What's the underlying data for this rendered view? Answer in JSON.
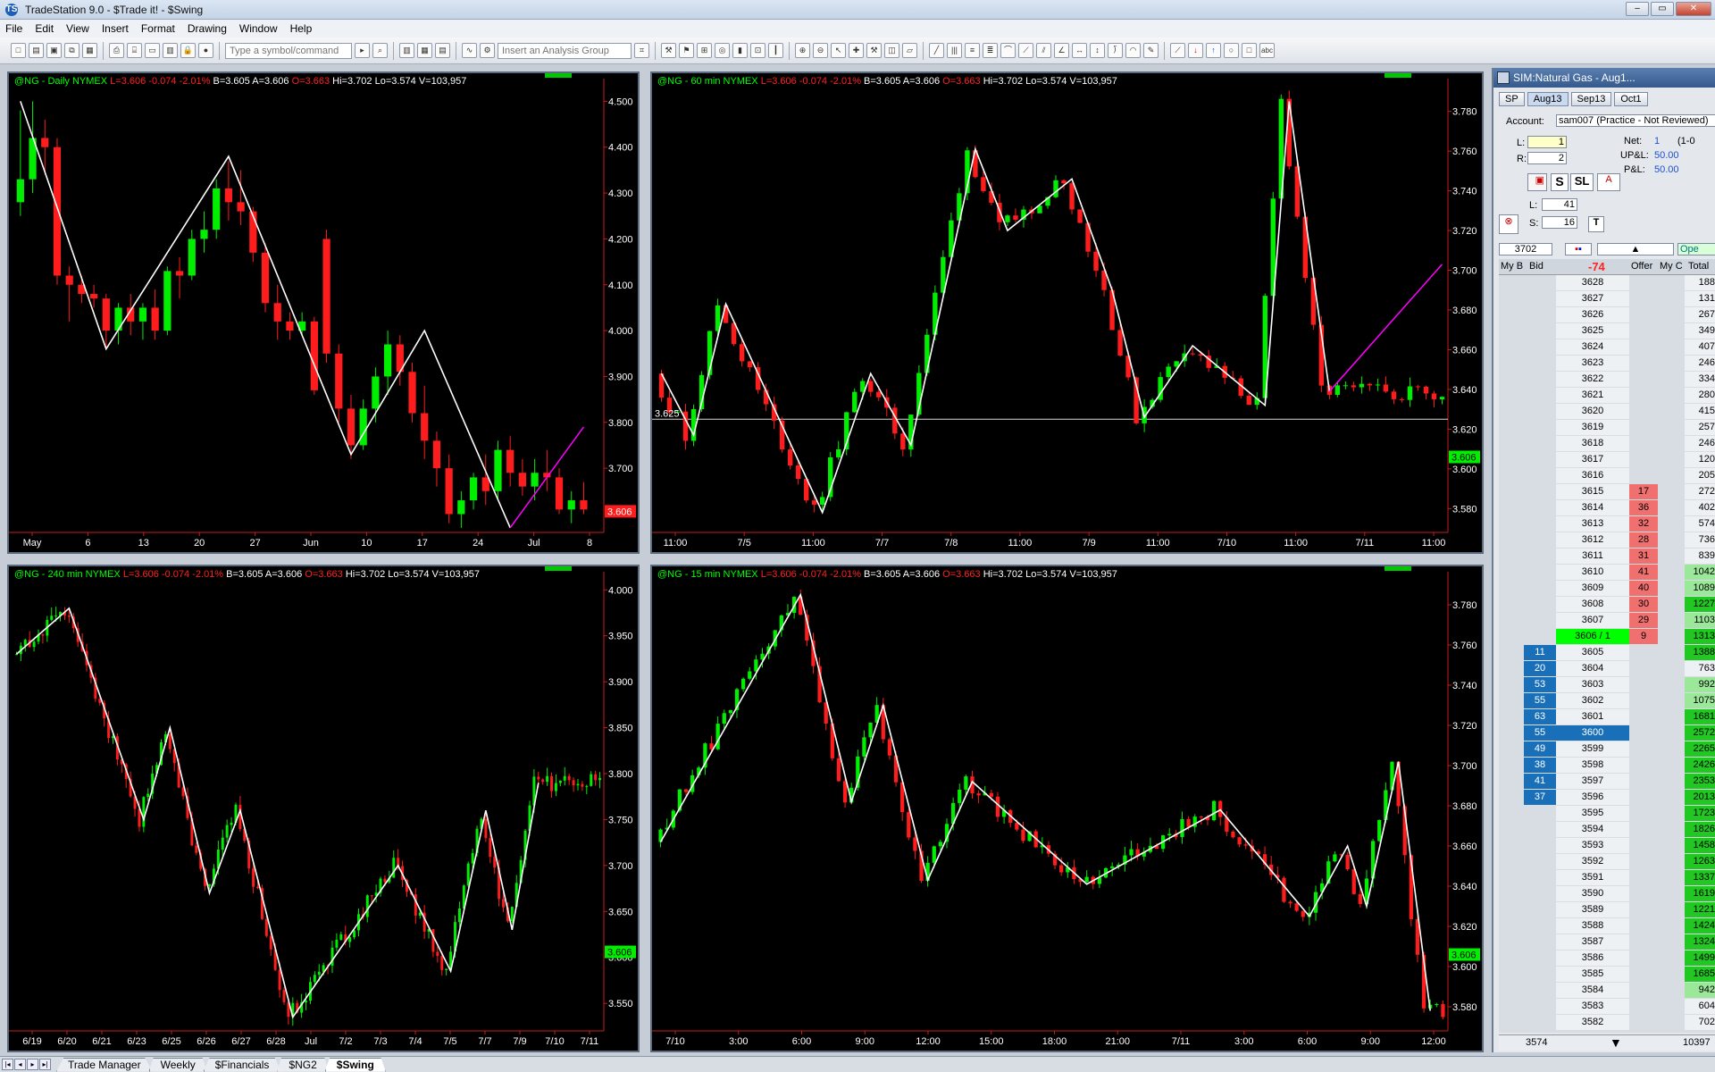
{
  "window": {
    "title": "TradeStation 9.0 - $Trade it! - $Swing",
    "logo": "TS"
  },
  "menu": [
    "File",
    "Edit",
    "View",
    "Insert",
    "Format",
    "Drawing",
    "Window",
    "Help"
  ],
  "toolbar": {
    "symbol_placeholder": "Type a symbol/command",
    "analysis_placeholder": "Insert an Analysis Group"
  },
  "colors": {
    "up": "#00ee00",
    "down": "#ff1c1c",
    "swing": "#ffffff",
    "projection": "#ff00ff",
    "axis": "#c81e1e"
  },
  "charts": [
    {
      "id": "daily",
      "sym": "@NG - Daily",
      "exch": "NYMEX",
      "last": "L=3.606",
      "chg": "-0.074",
      "pct": "-2.01%",
      "bid": "B=3.605",
      "ask": "A=3.606",
      "open": "O=3.663",
      "hi": "Hi=3.702",
      "lo": "Lo=3.574",
      "vol": "V=103,957",
      "ylim": [
        3.56,
        4.53
      ],
      "yticks": [
        "4.500",
        "4.400",
        "4.300",
        "4.200",
        "4.100",
        "4.000",
        "3.900",
        "3.800",
        "3.700"
      ],
      "ytick_values": [
        4.5,
        4.4,
        4.3,
        4.2,
        4.1,
        4.0,
        3.9,
        3.8,
        3.7
      ],
      "xticks": [
        "May",
        "6",
        "13",
        "20",
        "27",
        "Jun",
        "10",
        "17",
        "24",
        "Jul",
        "8"
      ],
      "price_label": "3.606",
      "price": 3.606,
      "price_box_color": "#ff1c1c",
      "swing": [
        [
          0,
          4.5
        ],
        [
          7,
          3.96
        ],
        [
          17,
          4.38
        ],
        [
          27,
          3.73
        ],
        [
          33,
          4.0
        ],
        [
          40,
          3.57
        ]
      ],
      "proj": [
        [
          40,
          3.57
        ],
        [
          46,
          3.79
        ]
      ],
      "hline": null,
      "hline_label": null,
      "nbars": 48,
      "bars": [
        [
          4.28,
          4.48,
          4.25,
          4.33
        ],
        [
          4.33,
          4.5,
          4.3,
          4.42
        ],
        [
          4.42,
          4.46,
          4.34,
          4.4
        ],
        [
          4.4,
          4.42,
          4.1,
          4.12
        ],
        [
          4.12,
          4.14,
          4.02,
          4.1
        ],
        [
          4.1,
          4.12,
          4.06,
          4.08
        ],
        [
          4.08,
          4.1,
          4.05,
          4.07
        ],
        [
          4.07,
          4.08,
          3.96,
          4.0
        ],
        [
          4.0,
          4.06,
          3.97,
          4.05
        ],
        [
          4.05,
          4.08,
          3.99,
          4.02
        ],
        [
          4.02,
          4.06,
          3.98,
          4.05
        ],
        [
          4.05,
          4.09,
          3.98,
          4.0
        ],
        [
          4.0,
          4.14,
          3.99,
          4.13
        ],
        [
          4.13,
          4.16,
          4.07,
          4.12
        ],
        [
          4.12,
          4.22,
          4.11,
          4.2
        ],
        [
          4.2,
          4.26,
          4.17,
          4.22
        ],
        [
          4.22,
          4.33,
          4.2,
          4.31
        ],
        [
          4.31,
          4.37,
          4.24,
          4.28
        ],
        [
          4.28,
          4.35,
          4.23,
          4.26
        ],
        [
          4.26,
          4.27,
          4.15,
          4.17
        ],
        [
          4.17,
          4.19,
          4.04,
          4.06
        ],
        [
          4.06,
          4.1,
          3.98,
          4.02
        ],
        [
          4.02,
          4.04,
          3.98,
          4.0
        ],
        [
          4.0,
          4.04,
          3.99,
          4.02
        ],
        [
          4.02,
          4.03,
          3.86,
          3.87
        ],
        [
          4.2,
          4.22,
          3.93,
          3.95
        ],
        [
          3.95,
          3.97,
          3.8,
          3.83
        ],
        [
          3.83,
          3.86,
          3.72,
          3.75
        ],
        [
          3.75,
          3.85,
          3.74,
          3.83
        ],
        [
          3.83,
          3.92,
          3.8,
          3.9
        ],
        [
          3.9,
          4.0,
          3.86,
          3.97
        ],
        [
          3.97,
          3.99,
          3.88,
          3.91
        ],
        [
          3.91,
          3.93,
          3.8,
          3.82
        ],
        [
          3.82,
          3.88,
          3.72,
          3.76
        ],
        [
          3.76,
          3.78,
          3.66,
          3.7
        ],
        [
          3.7,
          3.73,
          3.58,
          3.6
        ],
        [
          3.6,
          3.65,
          3.57,
          3.63
        ],
        [
          3.63,
          3.69,
          3.61,
          3.68
        ],
        [
          3.68,
          3.73,
          3.62,
          3.65
        ],
        [
          3.65,
          3.76,
          3.63,
          3.74
        ],
        [
          3.74,
          3.77,
          3.66,
          3.69
        ],
        [
          3.69,
          3.72,
          3.64,
          3.66
        ],
        [
          3.66,
          3.72,
          3.63,
          3.69
        ],
        [
          3.69,
          3.74,
          3.65,
          3.68
        ],
        [
          3.68,
          3.7,
          3.6,
          3.61
        ],
        [
          3.61,
          3.65,
          3.58,
          3.63
        ],
        [
          3.63,
          3.67,
          3.6,
          3.61
        ]
      ]
    },
    {
      "id": "m60",
      "sym": "@NG - 60 min",
      "exch": "NYMEX",
      "last": "L=3.606",
      "chg": "-0.074",
      "pct": "-2.01%",
      "bid": "B=3.605",
      "ask": "A=3.606",
      "open": "O=3.663",
      "hi": "Hi=3.702",
      "lo": "Lo=3.574",
      "vol": "V=103,957",
      "ylim": [
        3.568,
        3.792
      ],
      "yticks": [
        "3.780",
        "3.760",
        "3.740",
        "3.720",
        "3.700",
        "3.680",
        "3.660",
        "3.640",
        "3.620",
        "3.600",
        "3.580"
      ],
      "ytick_values": [
        3.78,
        3.76,
        3.74,
        3.72,
        3.7,
        3.68,
        3.66,
        3.64,
        3.62,
        3.6,
        3.58
      ],
      "xticks": [
        "11:00",
        "7/5",
        "11:00",
        "7/7",
        "7/8",
        "11:00",
        "7/9",
        "11:00",
        "7/10",
        "11:00",
        "7/11",
        "11:00"
      ],
      "price_label": "3.606",
      "price": 3.606,
      "price_box_color": "#00ee00",
      "swing": [
        [
          0,
          3.648
        ],
        [
          4,
          3.617
        ],
        [
          8,
          3.683
        ],
        [
          20,
          3.578
        ],
        [
          26,
          3.648
        ],
        [
          31,
          3.612
        ],
        [
          39,
          3.761
        ],
        [
          43,
          3.72
        ],
        [
          51,
          3.746
        ],
        [
          56,
          3.69
        ],
        [
          60,
          3.626
        ],
        [
          66,
          3.662
        ],
        [
          75,
          3.632
        ],
        [
          78,
          3.785
        ],
        [
          83,
          3.639
        ]
      ],
      "proj": [
        [
          83,
          3.639
        ],
        [
          97,
          3.703
        ]
      ],
      "hline": 3.625,
      "hline_label": "3.625",
      "nbars": 98,
      "bars": []
    },
    {
      "id": "m240",
      "sym": "@NG - 240 min",
      "exch": "NYMEX",
      "last": "L=3.606",
      "chg": "-0.074",
      "pct": "-2.01%",
      "bid": "B=3.605",
      "ask": "A=3.606",
      "open": "O=3.663",
      "hi": "Hi=3.702",
      "lo": "Lo=3.574",
      "vol": "V=103,957",
      "ylim": [
        3.52,
        4.01
      ],
      "yticks": [
        "4.000",
        "3.950",
        "3.900",
        "3.850",
        "3.800",
        "3.750",
        "3.700",
        "3.650",
        "3.600",
        "3.550"
      ],
      "ytick_values": [
        4.0,
        3.95,
        3.9,
        3.85,
        3.8,
        3.75,
        3.7,
        3.65,
        3.6,
        3.55
      ],
      "xticks": [
        "6/19",
        "6/20",
        "6/21",
        "6/23",
        "6/25",
        "6/26",
        "6/27",
        "6/28",
        "Jul",
        "7/2",
        "7/3",
        "7/4",
        "7/5",
        "7/7",
        "7/9",
        "7/10",
        "7/11"
      ],
      "price_label": "3.606",
      "price": 3.606,
      "price_box_color": "#00ee00",
      "swing": [
        [
          0,
          3.93
        ],
        [
          12,
          3.98
        ],
        [
          29,
          3.75
        ],
        [
          35,
          3.85
        ],
        [
          44,
          3.67
        ],
        [
          51,
          3.76
        ],
        [
          63,
          3.535
        ],
        [
          87,
          3.7
        ],
        [
          99,
          3.585
        ],
        [
          107,
          3.76
        ],
        [
          113,
          3.63
        ],
        [
          119,
          3.79
        ]
      ],
      "proj": null,
      "hline": null,
      "hline_label": null,
      "nbars": 134,
      "bars": []
    },
    {
      "id": "m15",
      "sym": "@NG - 15 min",
      "exch": "NYMEX",
      "last": "L=3.606",
      "chg": "-0.074",
      "pct": "-2.01%",
      "bid": "B=3.605",
      "ask": "A=3.606",
      "open": "O=3.663",
      "hi": "Hi=3.702",
      "lo": "Lo=3.574",
      "vol": "V=103,957",
      "ylim": [
        3.568,
        3.792
      ],
      "yticks": [
        "3.780",
        "3.760",
        "3.740",
        "3.720",
        "3.700",
        "3.680",
        "3.660",
        "3.640",
        "3.620",
        "3.600",
        "3.580"
      ],
      "ytick_values": [
        3.78,
        3.76,
        3.74,
        3.72,
        3.7,
        3.68,
        3.66,
        3.64,
        3.62,
        3.6,
        3.58
      ],
      "xticks": [
        "7/10",
        "3:00",
        "6:00",
        "9:00",
        "12:00",
        "15:00",
        "18:00",
        "21:00",
        "7/11",
        "3:00",
        "6:00",
        "9:00",
        "12:00"
      ],
      "price_label": "3.606",
      "price": 3.606,
      "price_box_color": "#00ee00",
      "swing": [
        [
          0,
          3.662
        ],
        [
          22,
          3.785
        ],
        [
          30,
          3.682
        ],
        [
          35,
          3.73
        ],
        [
          42,
          3.643
        ],
        [
          49,
          3.692
        ],
        [
          67,
          3.641
        ],
        [
          88,
          3.678
        ],
        [
          102,
          3.625
        ],
        [
          108,
          3.66
        ],
        [
          111,
          3.63
        ],
        [
          116,
          3.702
        ],
        [
          121,
          3.578
        ]
      ],
      "proj": null,
      "hline": null,
      "hline_label": null,
      "nbars": 124,
      "bars": []
    }
  ],
  "dom": {
    "title": "SIM:Natural Gas - Aug1...",
    "tabs": [
      "SP",
      "Aug13",
      "Sep13",
      "Oct1"
    ],
    "account_label": "Account:",
    "account_value": "sam007 (Practice - Not Reviewed)",
    "L_label": "L:",
    "L_value": "1",
    "R_label": "R:",
    "R_value": "2",
    "net_label": "Net:",
    "net_value": "1",
    "net_extra": "(1-0",
    "upl_label": "UP&L:",
    "upl_value": "50.00",
    "pl_label": "P&L:",
    "pl_value": "50.00",
    "s_button": "S",
    "sl_button": "SL",
    "L2_label": "L:",
    "L2_value": "41",
    "S2_label": "S:",
    "S2_value": "16",
    "t_button": "T",
    "high": "3702",
    "net_change": "-74",
    "open_label": "Ope",
    "headers": [
      "My B",
      "Bid",
      "",
      "Offer",
      "My C",
      "Total"
    ],
    "low": "3574",
    "total_footer": "10397",
    "rows": [
      [
        "",
        "",
        "3628",
        "",
        "",
        "188"
      ],
      [
        "",
        "",
        "3627",
        "",
        "",
        "131"
      ],
      [
        "",
        "",
        "3626",
        "",
        "",
        "267"
      ],
      [
        "",
        "",
        "3625",
        "",
        "",
        "349"
      ],
      [
        "",
        "",
        "3624",
        "",
        "",
        "407"
      ],
      [
        "",
        "",
        "3623",
        "",
        "",
        "246"
      ],
      [
        "",
        "",
        "3622",
        "",
        "",
        "334"
      ],
      [
        "",
        "",
        "3621",
        "",
        "",
        "280"
      ],
      [
        "",
        "",
        "3620",
        "",
        "",
        "415"
      ],
      [
        "",
        "",
        "3619",
        "",
        "",
        "257"
      ],
      [
        "",
        "",
        "3618",
        "",
        "",
        "246"
      ],
      [
        "",
        "",
        "3617",
        "",
        "",
        "120"
      ],
      [
        "",
        "",
        "3616",
        "",
        "",
        "205"
      ],
      [
        "",
        "",
        "3615",
        "17",
        "",
        "272"
      ],
      [
        "",
        "",
        "3614",
        "36",
        "",
        "402"
      ],
      [
        "",
        "",
        "3613",
        "32",
        "",
        "574"
      ],
      [
        "",
        "",
        "3612",
        "28",
        "",
        "736"
      ],
      [
        "",
        "",
        "3611",
        "31",
        "",
        "839"
      ],
      [
        "",
        "",
        "3610",
        "41",
        "",
        "1042"
      ],
      [
        "",
        "",
        "3609",
        "40",
        "",
        "1089"
      ],
      [
        "",
        "",
        "3608",
        "30",
        "",
        "1227"
      ],
      [
        "",
        "",
        "3607",
        "29",
        "",
        "1103"
      ],
      [
        "",
        "",
        "3606 / 1",
        "9",
        "",
        "1313"
      ],
      [
        "",
        "11",
        "3605",
        "",
        "",
        "1388"
      ],
      [
        "",
        "20",
        "3604",
        "",
        "",
        "763"
      ],
      [
        "",
        "53",
        "3603",
        "",
        "",
        "992"
      ],
      [
        "",
        "55",
        "3602",
        "",
        "",
        "1075"
      ],
      [
        "",
        "63",
        "3601",
        "",
        "",
        "1681"
      ],
      [
        "",
        "55",
        "3600",
        "",
        "",
        "2572"
      ],
      [
        "",
        "49",
        "3599",
        "",
        "",
        "2265"
      ],
      [
        "",
        "38",
        "3598",
        "",
        "",
        "2426"
      ],
      [
        "",
        "41",
        "3597",
        "",
        "",
        "2353"
      ],
      [
        "",
        "37",
        "3596",
        "",
        "",
        "2013"
      ],
      [
        "",
        "",
        "3595",
        "",
        "",
        "1723"
      ],
      [
        "",
        "",
        "3594",
        "",
        "",
        "1826"
      ],
      [
        "",
        "",
        "3593",
        "",
        "",
        "1458"
      ],
      [
        "",
        "",
        "3592",
        "",
        "",
        "1263"
      ],
      [
        "",
        "",
        "3591",
        "",
        "",
        "1337"
      ],
      [
        "",
        "",
        "3590",
        "",
        "",
        "1619"
      ],
      [
        "",
        "",
        "3589",
        "",
        "",
        "1221"
      ],
      [
        "",
        "",
        "3588",
        "",
        "",
        "1424"
      ],
      [
        "",
        "",
        "3587",
        "",
        "",
        "1324"
      ],
      [
        "",
        "",
        "3586",
        "",
        "",
        "1499"
      ],
      [
        "",
        "",
        "3585",
        "",
        "",
        "1685"
      ],
      [
        "",
        "",
        "3584",
        "",
        "",
        "942"
      ],
      [
        "",
        "",
        "3583",
        "",
        "",
        "604"
      ],
      [
        "",
        "",
        "3582",
        "",
        "",
        "702"
      ]
    ]
  },
  "workspace_tabs": [
    "Trade Manager",
    "Weekly",
    "$Financials",
    "$NG2",
    "$Swing"
  ],
  "active_tab": "$Swing"
}
